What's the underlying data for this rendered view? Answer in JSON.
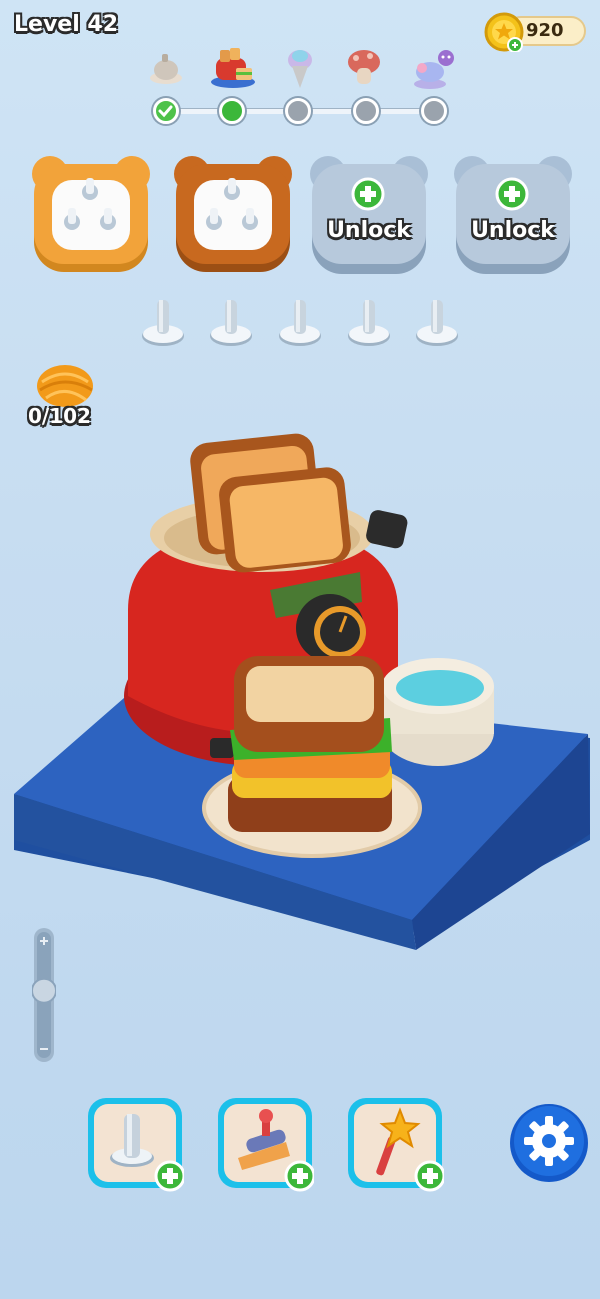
{
  "header": {
    "level_label": "Level 42",
    "coins": "920"
  },
  "progress": {
    "stages": [
      {
        "name": "teapot",
        "state": "done"
      },
      {
        "name": "toaster-breakfast",
        "state": "current"
      },
      {
        "name": "ice-cream",
        "state": "locked"
      },
      {
        "name": "mushroom-house",
        "state": "locked"
      },
      {
        "name": "carousel-boss",
        "state": "locked"
      }
    ]
  },
  "boxes": [
    {
      "color": "#f2a33a",
      "state": "unlocked"
    },
    {
      "color": "#c8691f",
      "state": "unlocked"
    },
    {
      "color": "#a9bfd6",
      "state": "locked",
      "label": "Unlock"
    },
    {
      "color": "#a9bfd6",
      "state": "locked",
      "label": "Unlock"
    }
  ],
  "yarn_counter": "0/102",
  "zoom": {
    "level": 0.55
  },
  "boosters": [
    {
      "icon": "peg-icon"
    },
    {
      "icon": "brush-icon"
    },
    {
      "icon": "magic-wand-icon"
    }
  ],
  "colors": {
    "accent_green": "#3cb73a",
    "settings_blue": "#1f6fe0",
    "background": "#c7ddf1"
  }
}
